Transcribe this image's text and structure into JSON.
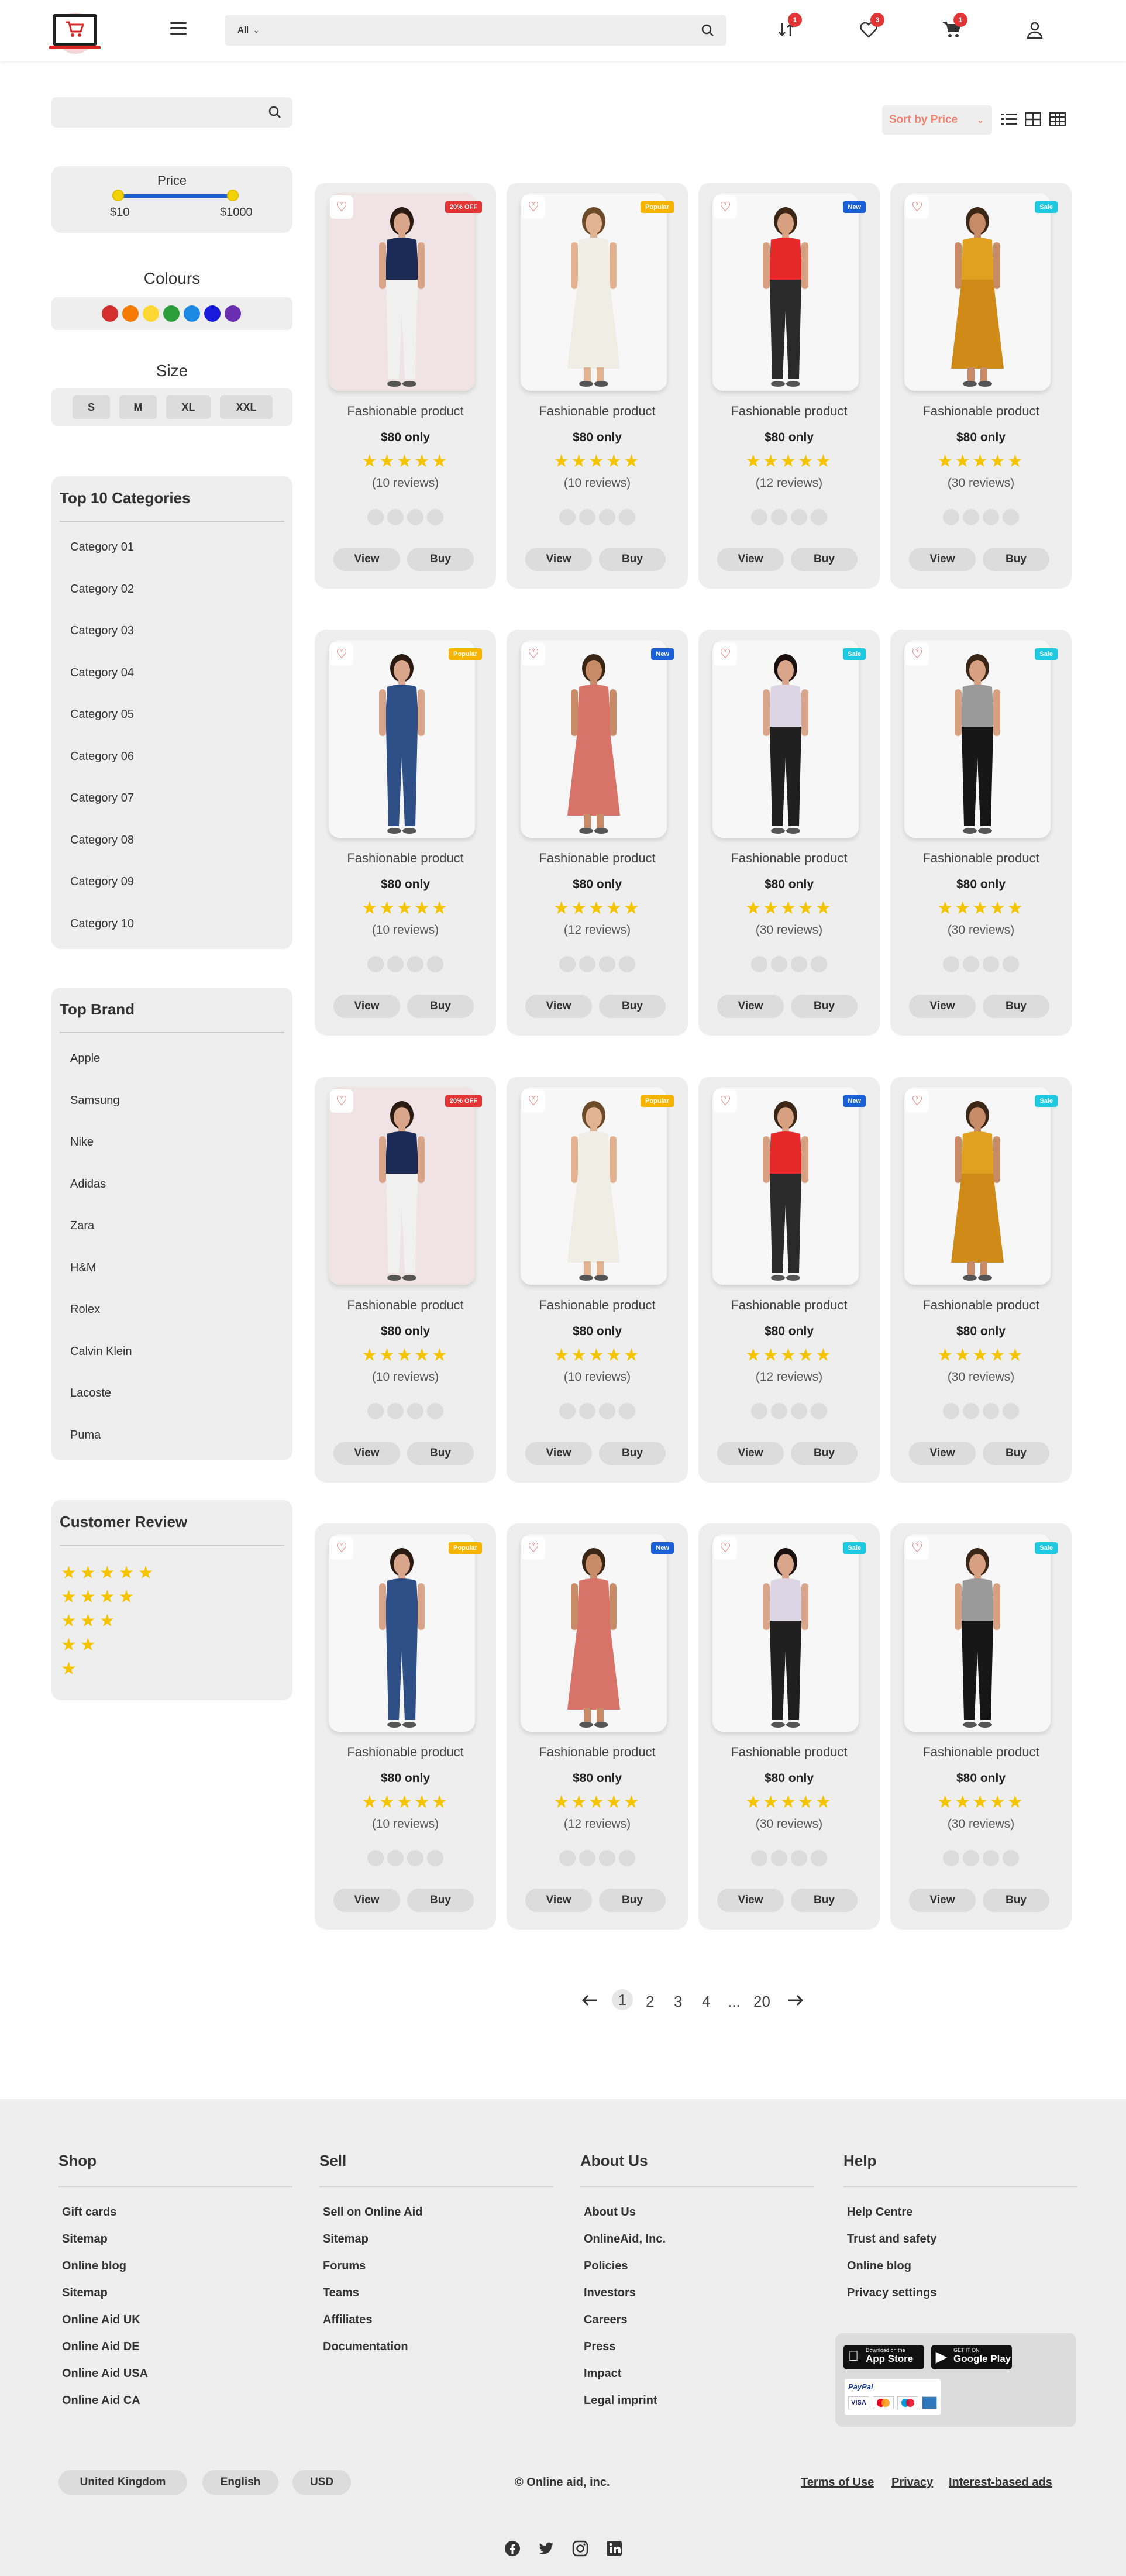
{
  "header": {
    "search_category": "All",
    "search_placeholder": "",
    "badges": {
      "compare": "1",
      "wishlist": "3",
      "cart": "1"
    }
  },
  "sidebar": {
    "search_placeholder": "",
    "price": {
      "title": "Price",
      "min_label": "$10",
      "max_label": "$1000"
    },
    "colours": {
      "title": "Colours",
      "swatches": [
        "#d32f2f",
        "#f57c00",
        "#fdd835",
        "#2e9e3a",
        "#1e88e5",
        "#1a1adb",
        "#6a2fb0"
      ]
    },
    "size": {
      "title": "Size",
      "options": [
        "S",
        "M",
        "XL",
        "XXL"
      ]
    },
    "categories": {
      "title": "Top 10 Categories",
      "items": [
        "Category 01",
        "Category 02",
        "Category 03",
        "Category 04",
        "Category 05",
        "Category 06",
        "Category 07",
        "Category 08",
        "Category 09",
        "Category 10"
      ]
    },
    "brands": {
      "title": "Top Brand",
      "items": [
        "Apple",
        "Samsung",
        "Nike",
        "Adidas",
        "Zara",
        "H&M",
        "Rolex",
        "Calvin Klein",
        "Lacoste",
        "Puma"
      ]
    },
    "reviews": {
      "title": "Customer Review",
      "star_rows": [
        5,
        4,
        3,
        2,
        1
      ]
    }
  },
  "toolbar": {
    "sort_label": "Sort by Price"
  },
  "products": [
    {
      "name": "Fashionable product",
      "price": "$80 only",
      "rating": 5,
      "reviews": "(10 reviews)",
      "tag": "20% OFF",
      "tag_color": "#e23636",
      "view": "View",
      "buy": "Buy"
    },
    {
      "name": "Fashionable product",
      "price": "$80 only",
      "rating": 5,
      "reviews": "(10 reviews)",
      "tag": "Popular",
      "tag_color": "#f5b400",
      "view": "View",
      "buy": "Buy"
    },
    {
      "name": "Fashionable product",
      "price": "$80 only",
      "rating": 5,
      "reviews": "(12 reviews)",
      "tag": "New",
      "tag_color": "#1a5fd6",
      "view": "View",
      "buy": "Buy"
    },
    {
      "name": "Fashionable product",
      "price": "$80 only",
      "rating": 5,
      "reviews": "(30 reviews)",
      "tag": "Sale",
      "tag_color": "#1ec8e0",
      "view": "View",
      "buy": "Buy"
    },
    {
      "name": "Fashionable product",
      "price": "$80 only",
      "rating": 5,
      "reviews": "(10 reviews)",
      "tag": "Popular",
      "tag_color": "#f5b400",
      "view": "View",
      "buy": "Buy"
    },
    {
      "name": "Fashionable product",
      "price": "$80 only",
      "rating": 5,
      "reviews": "(12 reviews)",
      "tag": "New",
      "tag_color": "#1a5fd6",
      "view": "View",
      "buy": "Buy"
    },
    {
      "name": "Fashionable product",
      "price": "$80 only",
      "rating": 5,
      "reviews": "(30 reviews)",
      "tag": "Sale",
      "tag_color": "#1ec8e0",
      "view": "View",
      "buy": "Buy"
    },
    {
      "name": "Fashionable product",
      "price": "$80 only",
      "rating": 5,
      "reviews": "(30 reviews)",
      "tag": "Sale",
      "tag_color": "#1ec8e0",
      "view": "View",
      "buy": "Buy"
    },
    {
      "name": "Fashionable product",
      "price": "$80 only",
      "rating": 5,
      "reviews": "(10 reviews)",
      "tag": "20% OFF",
      "tag_color": "#e23636",
      "view": "View",
      "buy": "Buy"
    },
    {
      "name": "Fashionable product",
      "price": "$80 only",
      "rating": 5,
      "reviews": "(10 reviews)",
      "tag": "Popular",
      "tag_color": "#f5b400",
      "view": "View",
      "buy": "Buy"
    },
    {
      "name": "Fashionable product",
      "price": "$80 only",
      "rating": 5,
      "reviews": "(12 reviews)",
      "tag": "New",
      "tag_color": "#1a5fd6",
      "view": "View",
      "buy": "Buy"
    },
    {
      "name": "Fashionable product",
      "price": "$80 only",
      "rating": 5,
      "reviews": "(30 reviews)",
      "tag": "Sale",
      "tag_color": "#1ec8e0",
      "view": "View",
      "buy": "Buy"
    },
    {
      "name": "Fashionable product",
      "price": "$80 only",
      "rating": 5,
      "reviews": "(10 reviews)",
      "tag": "Popular",
      "tag_color": "#f5b400",
      "view": "View",
      "buy": "Buy"
    },
    {
      "name": "Fashionable product",
      "price": "$80 only",
      "rating": 5,
      "reviews": "(12 reviews)",
      "tag": "New",
      "tag_color": "#1a5fd6",
      "view": "View",
      "buy": "Buy"
    },
    {
      "name": "Fashionable product",
      "price": "$80 only",
      "rating": 5,
      "reviews": "(30 reviews)",
      "tag": "Sale",
      "tag_color": "#1ec8e0",
      "view": "View",
      "buy": "Buy"
    },
    {
      "name": "Fashionable product",
      "price": "$80 only",
      "rating": 5,
      "reviews": "(30 reviews)",
      "tag": "Sale",
      "tag_color": "#1ec8e0",
      "view": "View",
      "buy": "Buy"
    }
  ],
  "pagination": {
    "pages": [
      "1",
      "2",
      "3",
      "4",
      "...",
      "20"
    ],
    "current": "1"
  },
  "footer": {
    "columns": [
      {
        "title": "Shop",
        "links": [
          "Gift cards",
          "Sitemap",
          "Online blog",
          "Sitemap",
          "Online Aid UK",
          "Online Aid DE",
          "Online Aid USA",
          "Online Aid CA"
        ]
      },
      {
        "title": "Sell",
        "links": [
          "Sell on Online Aid",
          "Sitemap",
          "Forums",
          "Teams",
          "Affiliates",
          "Documentation"
        ]
      },
      {
        "title": "About Us",
        "links": [
          "About Us",
          "OnlineAid, Inc.",
          "Policies",
          "Investors",
          "Careers",
          "Press",
          "Impact",
          "Legal imprint"
        ]
      },
      {
        "title": "Help",
        "links": [
          "Help Centre",
          "Trust and safety",
          "Online blog",
          "Privacy settings"
        ]
      }
    ],
    "app_store": {
      "small": "Download on the",
      "label": "App Store"
    },
    "google_play": {
      "small": "GET IT ON",
      "label": "Google Play"
    },
    "payments": [
      "PayPal",
      "VISA"
    ],
    "region": "United Kingdom",
    "language": "English",
    "currency": "USD",
    "copyright": "©   Online aid, inc.",
    "legal": [
      "Terms of Use",
      "Privacy",
      "Interest-based ads"
    ]
  }
}
